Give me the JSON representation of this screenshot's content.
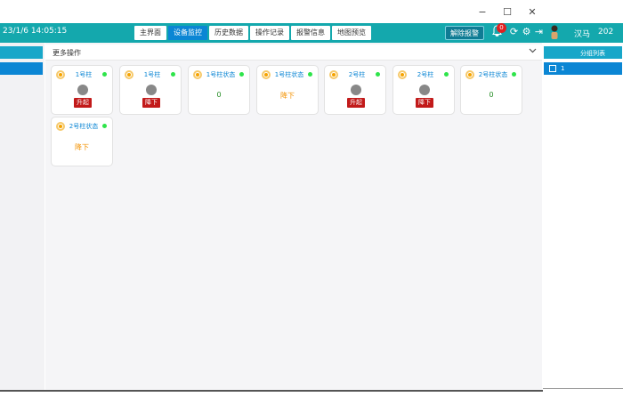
{
  "window_controls": {
    "minimize": "−",
    "maximize": "☐",
    "close": "✕"
  },
  "header": {
    "datetime": "23/1/6 14:05:15",
    "tabs": [
      {
        "label": "主界面",
        "active": false
      },
      {
        "label": "设备监控",
        "active": true
      },
      {
        "label": "历史数据",
        "active": false
      },
      {
        "label": "操作记录",
        "active": false
      },
      {
        "label": "报警信息",
        "active": false
      },
      {
        "label": "地图预览",
        "active": false
      }
    ],
    "unlock_alarm": "解除报警",
    "bell_badge": "0",
    "icons": [
      "bell-icon",
      "refresh-icon",
      "settings-icon",
      "logout-icon"
    ]
  },
  "user": {
    "name": "汉马",
    "year_fragment": "202"
  },
  "toolbar": {
    "more_ops": "更多操作"
  },
  "cards": [
    {
      "title": "1号柱",
      "type": "control",
      "button": "升起"
    },
    {
      "title": "1号柱",
      "type": "control",
      "button": "降下"
    },
    {
      "title": "1号柱状态",
      "type": "value",
      "value": "0",
      "value_color": "green"
    },
    {
      "title": "1号柱状态",
      "type": "value",
      "value": "降下",
      "value_color": "orange"
    },
    {
      "title": "2号柱",
      "type": "control",
      "button": "升起"
    },
    {
      "title": "2号柱",
      "type": "control",
      "button": "降下"
    },
    {
      "title": "2号柱状态",
      "type": "value",
      "value": "0",
      "value_color": "green"
    },
    {
      "title": "2号柱状态",
      "type": "value",
      "value": "降下",
      "value_color": "orange"
    }
  ],
  "group_panel": {
    "title": "分组列表",
    "items": [
      {
        "label": "1"
      }
    ]
  },
  "colors": {
    "header": "#14a8ad",
    "active_tab": "#0b86d4",
    "alarm_button": "#c21a1a",
    "status_dot": "#2ee44a",
    "value_green": "#228b22",
    "value_orange": "#f39200"
  }
}
